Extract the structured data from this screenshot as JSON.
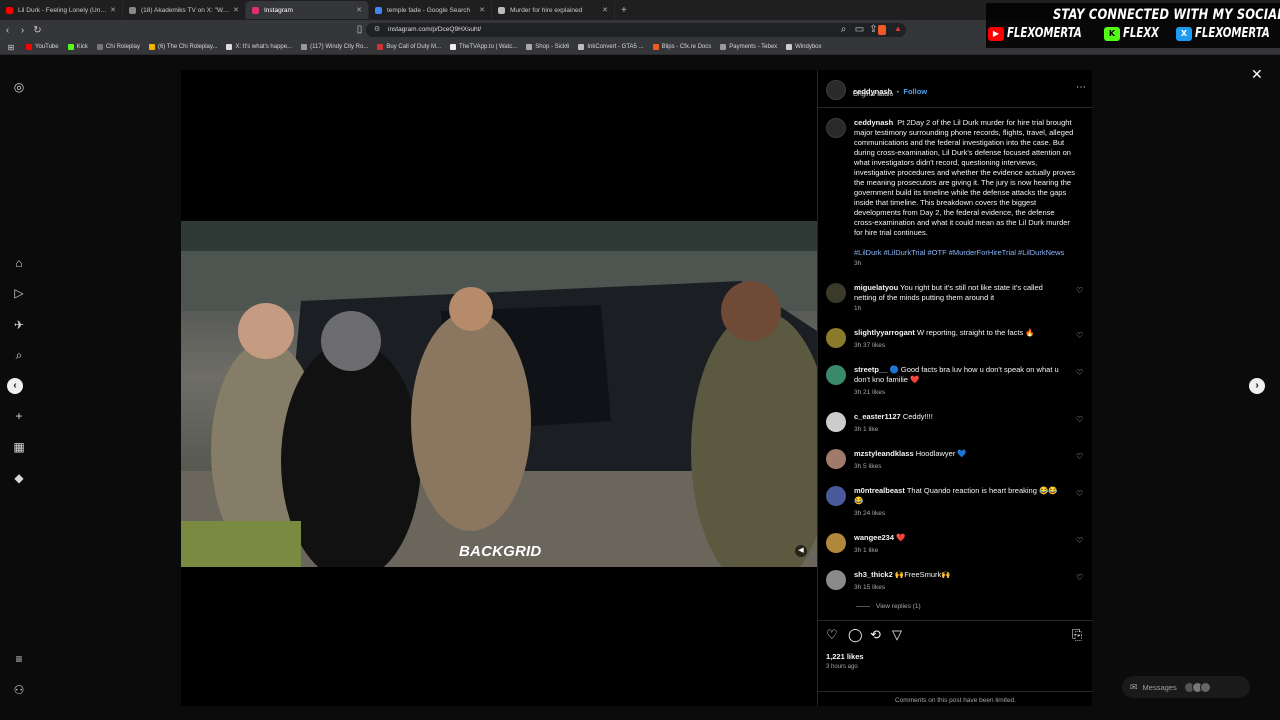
{
  "browser": {
    "tabs": [
      {
        "label": "Lil Durk - Feeling Lonely (Unrelea",
        "color": "#ff0000",
        "active": false
      },
      {
        "label": "(18) Akademiks TV on X: \"Wack100 d",
        "color": "#888888",
        "active": false
      },
      {
        "label": "Instagram",
        "color": "#e1306c",
        "active": true
      },
      {
        "label": "temple fade - Google Search",
        "color": "#4285f4",
        "active": false
      },
      {
        "label": "Murder for hire explained",
        "color": "#bbbbbb",
        "active": false
      }
    ],
    "url": "instagram.com/p/DceQ9HXsuht/",
    "bookmarks": [
      {
        "label": "YouTube",
        "color": "#ff0000"
      },
      {
        "label": "Kick",
        "color": "#53fc18"
      },
      {
        "label": "Chi Roleplay",
        "color": "#777777"
      },
      {
        "label": "(6) The Chi Roleplay...",
        "color": "#f4b400"
      },
      {
        "label": "X: It's what's happe...",
        "color": "#dddddd"
      },
      {
        "label": "(117) Windy City Ro...",
        "color": "#999999"
      },
      {
        "label": "Buy Call of Duty M...",
        "color": "#cc3333"
      },
      {
        "label": "TheTVApp.to | Watc...",
        "color": "#eeeeee"
      },
      {
        "label": "Shop - Sick6",
        "color": "#aaaaaa"
      },
      {
        "label": "InkConvert - GTA5 ...",
        "color": "#bbbbbb"
      },
      {
        "label": "Blips - Cfx.re Docs",
        "color": "#f25c22"
      },
      {
        "label": "Payments - Tebex",
        "color": "#999999"
      },
      {
        "label": "Windybox",
        "color": "#cccccc"
      }
    ]
  },
  "overlay": {
    "title": "STAY CONNECTED WITH MY SOCIALS",
    "socials": [
      {
        "icon": "youtube-icon",
        "name": "FLEXOMERTA",
        "color": "#ff0000"
      },
      {
        "icon": "kick-icon",
        "name": "FLEXX",
        "color": "#53fc18"
      },
      {
        "icon": "x-icon",
        "name": "FLEXOMERTA",
        "color": "#1d9bf0"
      }
    ]
  },
  "post": {
    "username": "ceddynash",
    "follow_label": "Follow",
    "audio": "Original audio",
    "caption": "Pt 2Day 2 of the Lil Durk murder for hire trial brought major testimony surrounding phone records, flights, travel, alleged communications and the federal investigation into the case. But during cross-examination, Lil Durk's defense focused attention on what investigators didn't record, questioning interviews, investigative procedures and whether the evidence actually proves the meaning prosecutors are giving it. The jury is now hearing the government build its timeline while the defense attacks the gaps inside that timeline. This breakdown covers the biggest developments from Day 2, the federal evidence, the defense cross-examination and what it could mean as the Lil Durk murder for hire trial continues.",
    "hashtags": "#LilDurk #LilDurkTrial #OTF #MurderForHireTrial #LilDurkNews",
    "caption_age": "3h",
    "watermark": "BACKGRID",
    "likes": "1,221 likes",
    "posted": "3 hours ago",
    "limited": "Comments on this post have been limited."
  },
  "comments": [
    {
      "user": "miguelatyou",
      "text": "You right but it's still not like state it's called netting of the minds putting them around it",
      "meta": "1h",
      "color": "#3a3a2a"
    },
    {
      "user": "slightlyyarrogant",
      "text": "W reporting, straight to the facts 🔥",
      "meta": "3h   37 likes",
      "color": "#8a7a2a"
    },
    {
      "user": "streetp__",
      "text": "🔵 Good facts bra luv how u don't speak on what u don't kno familie ❤️",
      "meta": "3h   21 likes",
      "color": "#3a8a6a"
    },
    {
      "user": "c_easter1127",
      "text": "Ceddy!!!!",
      "meta": "3h   1 like",
      "color": "#cccccc"
    },
    {
      "user": "mzstyleandklass",
      "text": "Hoodlawyer 💙",
      "meta": "3h   5 likes",
      "color": "#a07a6a"
    },
    {
      "user": "m0ntrealbeast",
      "text": "That Quando reaction is heart breaking 😂😂😂",
      "meta": "3h   24 likes",
      "color": "#4a5a9a"
    },
    {
      "user": "wangee234",
      "text": "❤️",
      "meta": "3h   1 like",
      "color": "#b08a3a"
    },
    {
      "user": "sh3_thick2",
      "text": "🙌FreeSmurk🙌",
      "meta": "3h   15 likes",
      "color": "#8a8a8a"
    }
  ],
  "view_replies": "View replies (1)",
  "messages_label": "Messages"
}
